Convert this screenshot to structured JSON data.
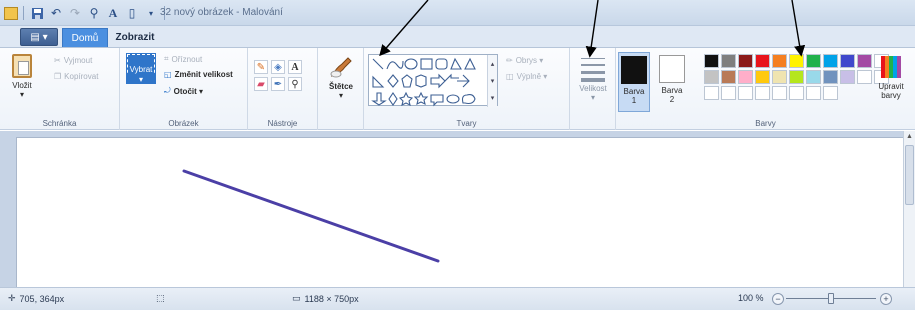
{
  "window": {
    "title": "32 nový obrázek - Malování"
  },
  "tabs": {
    "file_label": "▤ ▾",
    "home": "Domů",
    "view": "Zobrazit"
  },
  "clipboard": {
    "paste": "Vložit",
    "cut": "Vyjmout",
    "copy": "Kopírovat",
    "label": "Schránka"
  },
  "image": {
    "select": "Vybrat",
    "crop": "Oříznout",
    "resize": "Změnit velikost",
    "rotate": "Otočit ▾",
    "label": "Obrázek"
  },
  "tools": {
    "label": "Nástroje",
    "brushes": "Štětce"
  },
  "shapes": {
    "label": "Tvary",
    "outline": "Obrys ▾",
    "fill": "Výplně ▾"
  },
  "size": {
    "label": "Velikost"
  },
  "colors": {
    "color1": "Barva 1",
    "color2": "Barva 2",
    "edit": "Upravit barvy",
    "label": "Barvy",
    "color1_value": "#111111",
    "color2_value": "#ffffff",
    "palette": [
      "#111111",
      "#7f7f7f",
      "#8b1a1a",
      "#e8141c",
      "#f57f20",
      "#fff200",
      "#20b14b",
      "#00a2e8",
      "#3f48cc",
      "#a349a4",
      "#ffffff",
      "#c3c3c3",
      "#b97a57",
      "#ffaec9",
      "#ffc90e",
      "#efe4b0",
      "#b5e61d",
      "#99d9ea",
      "#7092be",
      "#c8bfe7",
      "#ffffff",
      "#ffffff",
      "#ffffff",
      "#ffffff",
      "#ffffff",
      "#ffffff",
      "#ffffff",
      "#ffffff",
      "#ffffff",
      "#ffffff"
    ]
  },
  "status": {
    "cursor_pos": "705, 364px",
    "canvas_size": "1188 × 750px",
    "zoom": "100 %"
  },
  "drawing": {
    "line_color": "#4b3fa6"
  }
}
